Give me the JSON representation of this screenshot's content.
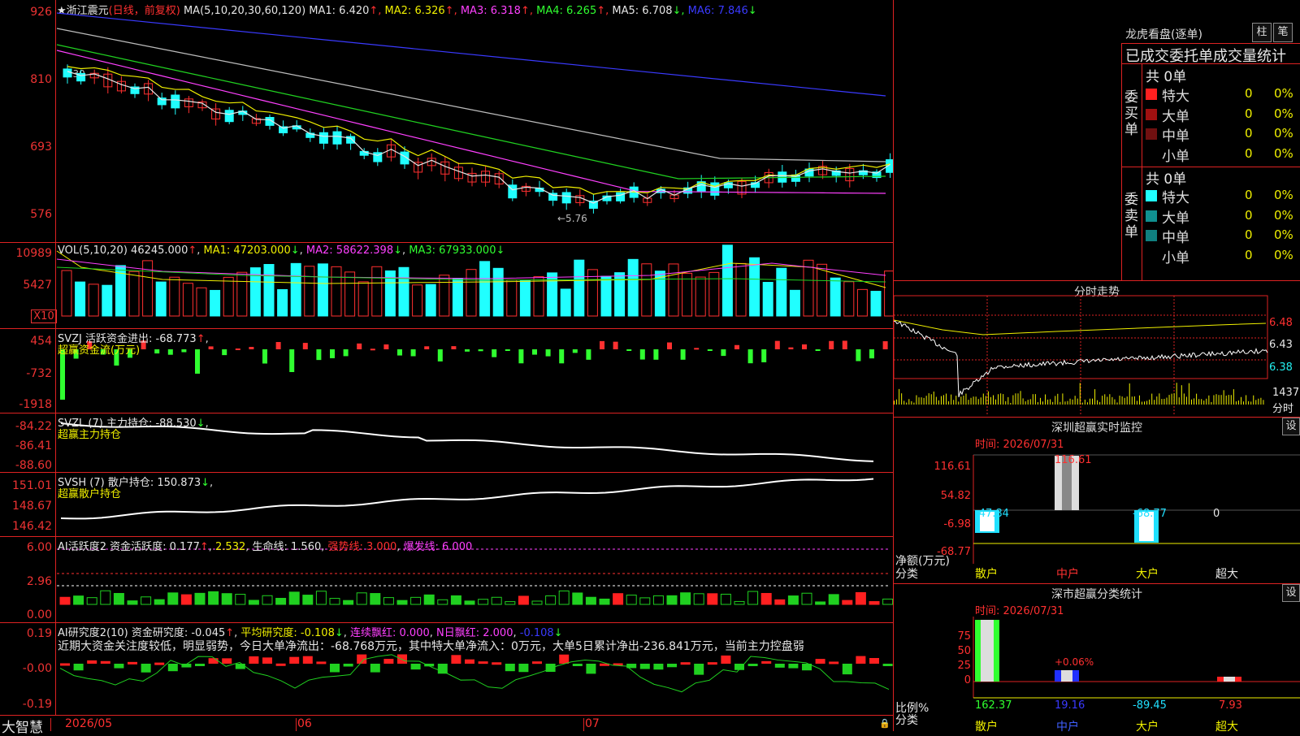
{
  "kline": {
    "stock_name": "浙江震元",
    "adj_label": "(日线，前复权)",
    "ma_params": "MA(5,10,20,30,60,120)",
    "ma_values": [
      {
        "label": "MA1: 6.420",
        "arrow": "↑",
        "color": "#e6e6e6"
      },
      {
        "label": "MA2: 6.326",
        "arrow": "↑",
        "color": "#f0f000"
      },
      {
        "label": "MA3: 6.318",
        "arrow": "↑",
        "color": "#ff40ff"
      },
      {
        "label": "MA4: 6.265",
        "arrow": "↑",
        "color": "#30ff30"
      },
      {
        "label": "MA5: 6.708",
        "arrow": "↓",
        "color": "#e6e6e6"
      },
      {
        "label": "MA6: 7.846",
        "arrow": "↓",
        "color": "#3a3aff"
      }
    ],
    "y_ticks": [
      "926",
      "810",
      "693",
      "576"
    ],
    "high_marker": "8.30",
    "low_marker": "←5.76"
  },
  "vol": {
    "header": "VOL(5,10,20)",
    "value": "46245.000",
    "ma1": "MA1: 47203.000",
    "ma2": "MA2: 58622.398",
    "ma3": "MA3: 67933.000",
    "y_ticks": [
      "10989",
      "5427"
    ],
    "unit": "X10"
  },
  "svzj": {
    "header": "SVZJ  活跃资金进出: -68.773",
    "subtitle": "超赢资金流(万元)",
    "y_ticks": [
      "454",
      "-732",
      "-1918"
    ]
  },
  "svzl": {
    "header": "SVZL (7) 主力持仓: -88.530",
    "subtitle": "超赢主力持仓",
    "y_ticks": [
      "-84.22",
      "-86.41",
      "-88.60"
    ]
  },
  "svsh": {
    "header": "SVSH (7) 散户持仓: 150.873",
    "subtitle": "超赢散户持仓",
    "y_ticks": [
      "151.01",
      "148.67",
      "146.42"
    ]
  },
  "ai_active": {
    "header_main": "AI活跃度2 资金活跃度: 0.177",
    "v2": "2.532",
    "life": "生命线: 1.560",
    "strong": "强势线: 3.000",
    "burst": "爆发线: 6.000",
    "y_ticks": [
      "6.00",
      "2.96",
      "0.00"
    ]
  },
  "ai_research": {
    "header_main": "AI研究度2(10) 资金研究度: -0.045",
    "avg": "平均研究度: -0.108",
    "streak": "连续飘红: 0.000",
    "nday": "N日飘红: 2.000",
    "last": "-0.108",
    "comment": "近期大资金关注度较低，明显弱势，今日大单净流出：-68.768万元，其中特大单净流入：0万元，大单5日累计净出-236.841万元，当前主力控盘弱",
    "y_ticks": [
      "0.19",
      "-0.00",
      "-0.19"
    ]
  },
  "footer": {
    "brand": "大智慧",
    "dates": [
      "2026/05",
      "06",
      "07"
    ]
  },
  "right": {
    "dragon_title": "龙虎看盘(逐单)",
    "btn_zhu": "柱",
    "btn_bi": "笔",
    "stat_title": "已成交委托单成交量统计",
    "buy_label": "委买单",
    "sell_label": "委卖单",
    "buy_total": "共 0单",
    "sell_total": "共 0单",
    "buy_rows": [
      {
        "name": "特大",
        "num": "0",
        "pct": "0%",
        "color": "#ff2020"
      },
      {
        "name": "大单",
        "num": "0",
        "pct": "0%",
        "color": "#a01010"
      },
      {
        "name": "中单",
        "num": "0",
        "pct": "0%",
        "color": "#701010"
      },
      {
        "name": "小单",
        "num": "0",
        "pct": "0%",
        "color": ""
      }
    ],
    "sell_rows": [
      {
        "name": "特大",
        "num": "0",
        "pct": "0%",
        "color": "#20ffff"
      },
      {
        "name": "大单",
        "num": "0",
        "pct": "0%",
        "color": "#109090"
      },
      {
        "name": "中单",
        "num": "0",
        "pct": "0%",
        "color": "#108080"
      },
      {
        "name": "小单",
        "num": "0",
        "pct": "0%",
        "color": ""
      }
    ],
    "intraday_title": "分时走势",
    "intraday_ticks": [
      "6.48",
      "6.43",
      "6.38"
    ],
    "intraday_vol": "1437",
    "intraday_label": "分时",
    "sz_title": "深圳超赢实时监控",
    "sz_setting": "设",
    "sz_time": "时间: 2026/07/31",
    "sz_ticks": [
      "116.61",
      "54.82",
      "-6.98",
      "-68.77"
    ],
    "sz_values": [
      "-47.84",
      "116.61",
      "-68.77",
      "0"
    ],
    "sz_ylabel": "净额(万元)",
    "sz_xlabel": "分类",
    "categories": [
      "散户",
      "中户",
      "大户",
      "超大"
    ],
    "cls_title": "深市超赢分类统计",
    "cls_setting": "设",
    "cls_time": "时间: 2026/07/31",
    "cls_ticks": [
      "75",
      "50",
      "25",
      "0"
    ],
    "cls_pct_label": "+0.06%",
    "cls_values": [
      "162.37",
      "19.16",
      "-89.45",
      "7.93"
    ],
    "cls_ylabel": "比例%",
    "cls_xlabel": "分类"
  }
}
